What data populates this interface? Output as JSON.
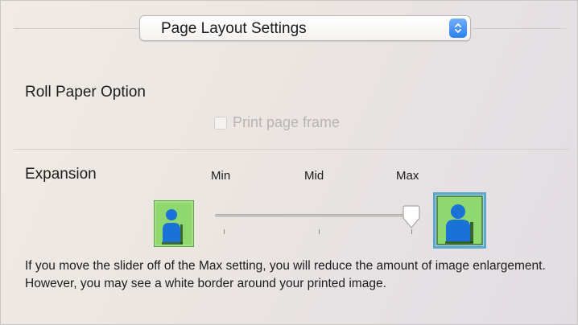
{
  "popup": {
    "selected": "Page Layout Settings",
    "stepper_icon": "up-down-chevron-icon"
  },
  "roll_paper": {
    "title": "Roll Paper Option",
    "checkbox_label": "Print page frame",
    "checked": false,
    "enabled": false
  },
  "expansion": {
    "title": "Expansion",
    "labels": [
      "Min",
      "Mid",
      "Max"
    ],
    "slider_level": "Max",
    "slider_value_fraction": 1.0,
    "min_icon": "person-small-icon",
    "max_icon": "person-large-icon"
  },
  "help_text": "If you move the slider off of the Max setting, you will reduce the amount of image enlargement. However, you may see a white border around your printed image.",
  "colors": {
    "accent": "#2a7ff1",
    "icon_green": "#8fd870",
    "icon_blue": "#1a72d6",
    "selected_frame": "#5aa9c8"
  }
}
